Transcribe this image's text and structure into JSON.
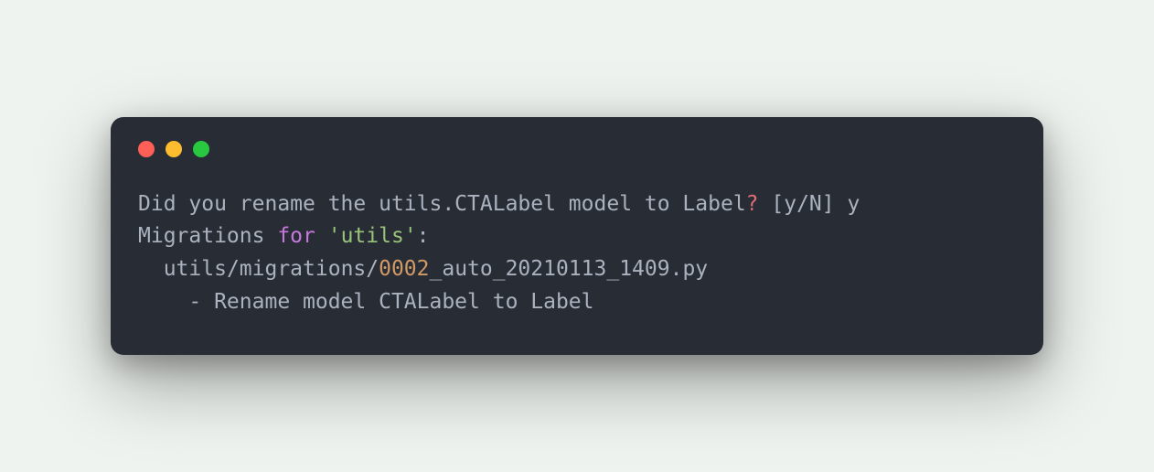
{
  "terminal": {
    "line1": {
      "pre": "Did you rename the utils.CTALabel model to Label",
      "qmark": "?",
      "post": " [y/N] y"
    },
    "line2": {
      "pre": "Migrations ",
      "keyword": "for",
      "mid": " ",
      "str": "'utils'",
      "post": ":"
    },
    "line3": {
      "indent": "  ",
      "pre": "utils/migrations/",
      "num": "0002",
      "post": "_auto_20210113_1409.py"
    },
    "line4": {
      "indent": "    ",
      "text": "- Rename model CTALabel to Label"
    }
  }
}
